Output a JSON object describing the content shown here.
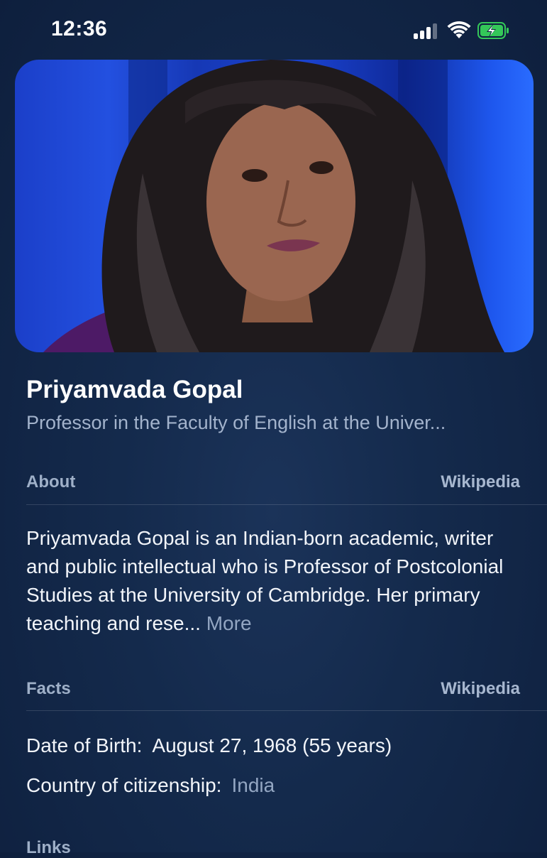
{
  "status_bar": {
    "time": "12:36",
    "signal_icon": "cellular-signal-icon",
    "wifi_icon": "wifi-icon",
    "battery_icon": "battery-charging-icon",
    "battery_color": "#34c759"
  },
  "hero": {
    "image_subject": "Portrait photo"
  },
  "profile": {
    "name": "Priyamvada Gopal",
    "subtitle": "Professor in the Faculty of English at the Univer..."
  },
  "about": {
    "label": "About",
    "source": "Wikipedia",
    "text": "Priyamvada Gopal is an Indian-born academic, writer and public intellectual who is Professor of Postcolonial Studies at the University of Cambridge. Her primary teaching and rese...",
    "more_label": "More"
  },
  "facts": {
    "label": "Facts",
    "source": "Wikipedia",
    "items": [
      {
        "key": "Date of Birth:",
        "value": "August 27, 1968 (55 years)"
      },
      {
        "key": "Country of citizenship:",
        "value": "India"
      }
    ]
  },
  "links": {
    "label": "Links"
  }
}
